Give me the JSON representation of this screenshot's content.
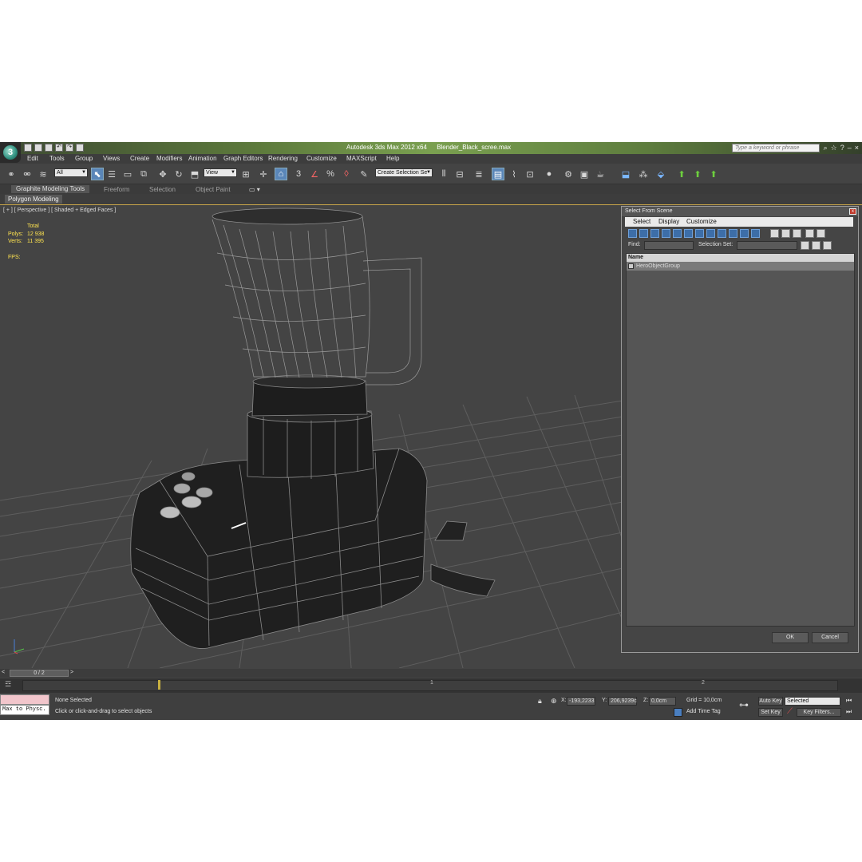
{
  "title_bar": {
    "app_name": "Autodesk 3ds Max  2012 x64",
    "file_name": "Blender_Black_scree.max",
    "search_placeholder": "Type a keyword or phrase"
  },
  "menu": [
    "Edit",
    "Tools",
    "Group",
    "Views",
    "Create",
    "Modifiers",
    "Animation",
    "Graph Editors",
    "Rendering",
    "Customize",
    "MAXScript",
    "Help"
  ],
  "toolbar": {
    "selection_filter": "All",
    "reference_coord": "View",
    "selection_set_placeholder": "Create Selection Se"
  },
  "ribbon": {
    "tabs": [
      "Graphite Modeling Tools",
      "Freeform",
      "Selection",
      "Object Paint"
    ],
    "active_panel": "Polygon Modeling"
  },
  "viewport": {
    "label": "[ + ] [ Perspective ] [ Shaded + Edged Faces ]",
    "stats": {
      "total_label": "Total",
      "polys_label": "Polys:",
      "polys_value": "12 938",
      "verts_label": "Verts:",
      "verts_value": "11 395"
    },
    "fps_label": "FPS:"
  },
  "dialog": {
    "title": "Select From Scene",
    "close": "x",
    "menu": [
      "Select",
      "Display",
      "Customize"
    ],
    "find_label": "Find:",
    "selection_set_label": "Selection Set:",
    "column_header": "Name",
    "items": [
      "HeroObjectGroup"
    ],
    "ok": "OK",
    "cancel": "Cancel"
  },
  "timeline": {
    "frame_display": "0 / 2",
    "prev": "<",
    "next": ">",
    "ticks": [
      "1",
      "2"
    ]
  },
  "status": {
    "maxscript_text": "Max to Physc.",
    "selection_status": "None Selected",
    "prompt": "Click or click-and-drag to select objects",
    "x_label": "X:",
    "x_value": "-193,2233",
    "y_label": "Y:",
    "y_value": "206,9239c",
    "z_label": "Z:",
    "z_value": "0,0cm",
    "grid": "Grid = 10,0cm",
    "add_time_tag": "Add Time Tag",
    "auto_key": "Auto Key",
    "auto_key_mode": "Selected",
    "set_key": "Set Key",
    "key_filters": "Key Filters..."
  },
  "colors": {
    "viewport_bg": "#444444",
    "stats_text": "#ffe450",
    "active_highlight": "#5a86b8",
    "title_bar_green": "#7aa050"
  }
}
